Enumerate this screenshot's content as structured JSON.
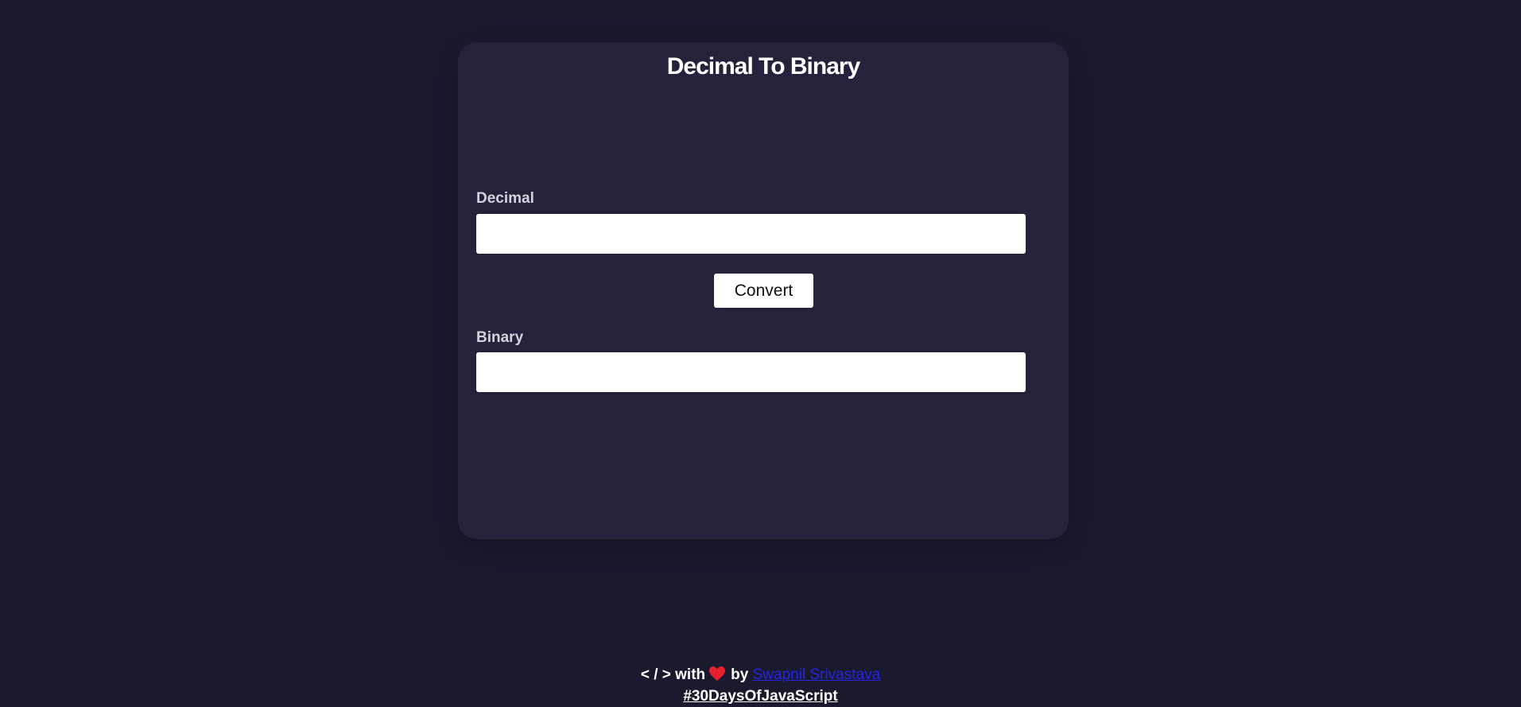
{
  "card": {
    "title": "Decimal To Binary",
    "decimal": {
      "label": "Decimal",
      "value": "",
      "placeholder": ""
    },
    "convert_button": "Convert",
    "binary": {
      "label": "Binary",
      "value": "",
      "placeholder": ""
    }
  },
  "footer": {
    "code_prefix": "< / > with",
    "heart_icon": "heart-icon",
    "by_text": "by",
    "author_name": "Swapnil Srivastava",
    "hashtag": "#30DaysOfJavaScript"
  },
  "colors": {
    "background": "#1b192e",
    "card": "#25233b",
    "heart": "#e8212e",
    "author_link": "#2323e8"
  }
}
